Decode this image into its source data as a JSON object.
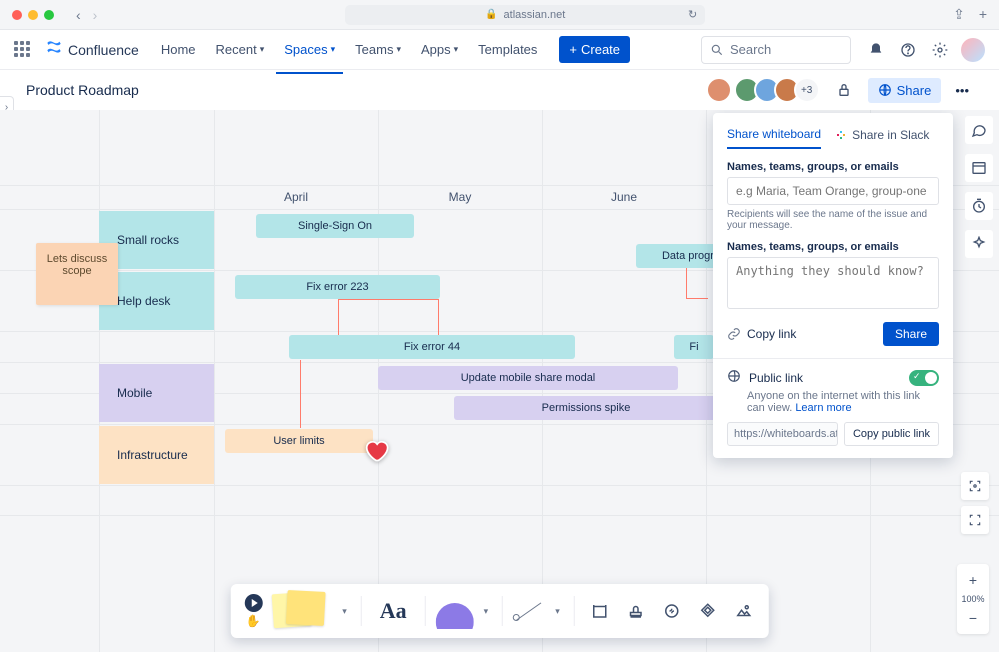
{
  "browser": {
    "url": "atlassian.net"
  },
  "nav": {
    "product": "Confluence",
    "items": [
      "Home",
      "Recent",
      "Spaces",
      "Teams",
      "Apps",
      "Templates"
    ],
    "selected_index": 2,
    "create": "Create",
    "search_placeholder": "Search"
  },
  "page": {
    "title": "Product Roadmap",
    "avatar_overflow": "+3",
    "share_label": "Share"
  },
  "timeline": {
    "months": [
      "April",
      "May",
      "June"
    ],
    "rows": [
      {
        "name": "Small rocks",
        "color": "teal"
      },
      {
        "name": "Help desk",
        "color": "teal"
      },
      {
        "name": "Mobile",
        "color": "purple"
      },
      {
        "name": "Infrastructure",
        "color": "peach"
      }
    ],
    "tasks": [
      {
        "label": "Single-Sign On",
        "color": "teal",
        "row": 0
      },
      {
        "label": "Data progra",
        "color": "teal",
        "row": 0
      },
      {
        "label": "Fix error 223",
        "color": "teal",
        "row": 1
      },
      {
        "label": "Fix error 44",
        "color": "teal",
        "row": 1
      },
      {
        "label": "Fi",
        "color": "teal",
        "row": 1
      },
      {
        "label": "Update mobile share modal",
        "color": "purple",
        "row": 2
      },
      {
        "label": "Permissions spike",
        "color": "purple",
        "row": 2
      },
      {
        "label": "User limits",
        "color": "peach",
        "row": 3
      }
    ],
    "sticky": "Lets discuss scope"
  },
  "share": {
    "tab_whiteboard": "Share whiteboard",
    "tab_slack": "Share in Slack",
    "names_label": "Names, teams, groups, or emails",
    "names_placeholder": "e.g Maria, Team Orange, group-one",
    "names_hint": "Recipients will see the name of the issue and your message.",
    "message_label": "Names, teams, groups, or emails",
    "message_placeholder": "Anything they should know?",
    "copy_link": "Copy link",
    "share_btn": "Share",
    "public_link_label": "Public link",
    "public_desc_1": "Anyone on the internet with this link can view.",
    "public_desc_learn": "Learn more",
    "public_url": "https://whiteboards.atlassian",
    "copy_public": "Copy public link"
  },
  "zoom": {
    "label": "100%"
  },
  "toolbar": {
    "text_tool": "Aa"
  }
}
